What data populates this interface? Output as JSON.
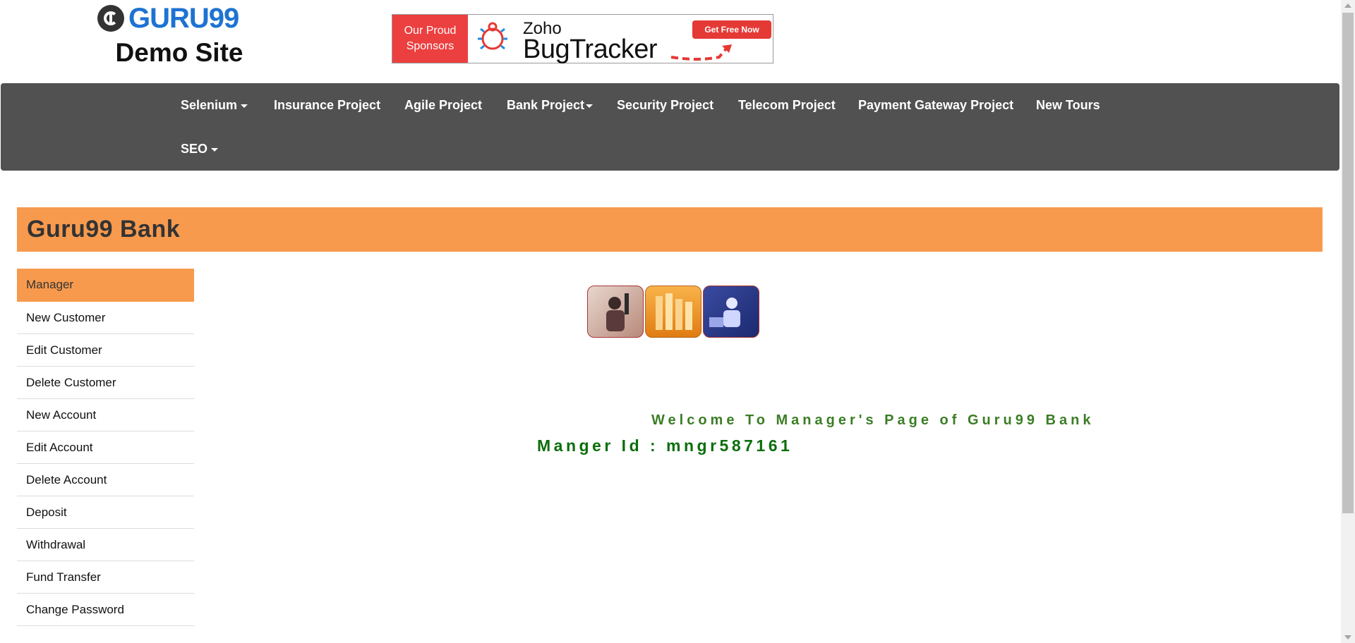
{
  "header": {
    "logo_text": "GURU99",
    "demo_site": "Demo Site",
    "sponsor": {
      "left_text_line1": "Our Proud",
      "left_text_line2": "Sponsors",
      "brand": "Zoho",
      "product": "BugTracker",
      "cta": "Get Free Now"
    }
  },
  "nav": {
    "items": [
      {
        "label": "Selenium",
        "dropdown": true
      },
      {
        "label": "Insurance Project",
        "dropdown": false
      },
      {
        "label": "Agile Project",
        "dropdown": false
      },
      {
        "label": "Bank Project",
        "dropdown": true
      },
      {
        "label": "Security Project",
        "dropdown": false
      },
      {
        "label": "Telecom Project",
        "dropdown": false
      },
      {
        "label": "Payment Gateway Project",
        "dropdown": false
      },
      {
        "label": "New Tours",
        "dropdown": false
      },
      {
        "label": "SEO",
        "dropdown": true
      }
    ]
  },
  "bank": {
    "title": "Guru99 Bank"
  },
  "sidebar": {
    "items": [
      {
        "label": "Manager"
      },
      {
        "label": "New Customer"
      },
      {
        "label": "Edit Customer"
      },
      {
        "label": "Delete Customer"
      },
      {
        "label": "New Account"
      },
      {
        "label": "Edit Account"
      },
      {
        "label": "Delete Account"
      },
      {
        "label": "Deposit"
      },
      {
        "label": "Withdrawal"
      },
      {
        "label": "Fund Transfer"
      },
      {
        "label": "Change Password"
      }
    ]
  },
  "main": {
    "welcome": "Welcome To Manager's Page of Guru99 Bank",
    "manager_id": "Manger Id : mngr587161"
  },
  "colors": {
    "accent": "#f79a4e",
    "navbar": "#515151",
    "welcome_green": "#3b7d25",
    "id_green": "#0b6e0b"
  }
}
